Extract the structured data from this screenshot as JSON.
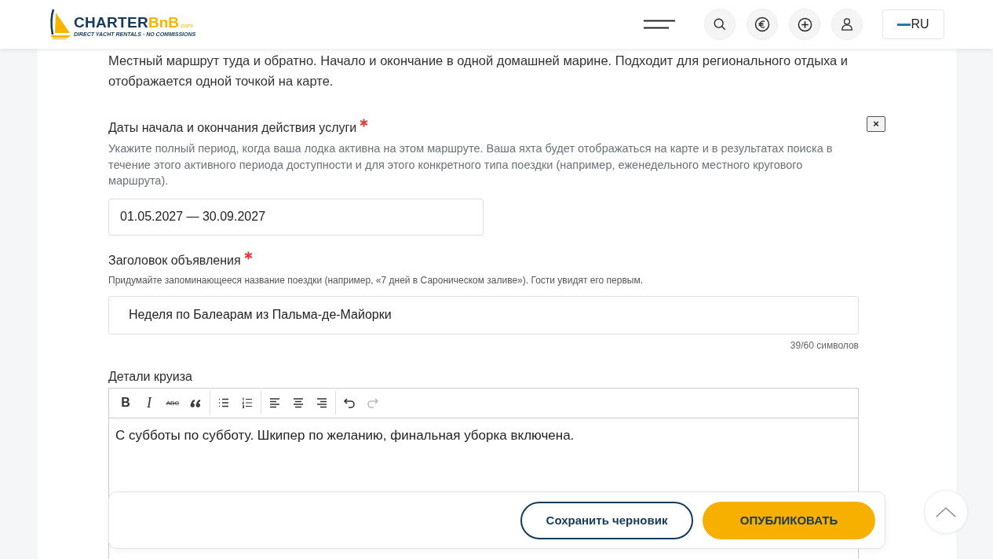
{
  "header": {
    "logo": {
      "brand": "CHARTER",
      "brand_accent": "BnB",
      "suffix": ".com",
      "tagline": "DIRECT YACHT RENTALS · NO COMMISSIONS"
    },
    "language": "RU"
  },
  "intro": "Местный маршрут туда и обратно. Начало и окончание в одной домашней марине. Подходит для регионального отдыха и отображается одной точкой на карте.",
  "dates": {
    "label": "Даты начала и окончания действия услуги",
    "required": true,
    "close": "×",
    "help": "Укажите полный период, когда ваша лодка активна на этом маршруте. Ваша яхта будет отображаться на карте и в результатах поиска в течение этого активного периода доступности и для этого конкретного типа поездки (например, еженедельного местного кругового маршрута).",
    "value": "01.05.2027 — 30.09.2027"
  },
  "title_field": {
    "label": "Заголовок объявления",
    "required": true,
    "help": "Придумайте запоминающееся название поездки (например, «7 дней в Сароническом заливе»). Гости увидят его первым.",
    "value": "Неделя по Балеарам из Пальма-де-Майорки",
    "counter": "39/60 символов"
  },
  "details": {
    "label": "Детали круиза",
    "toolbar_groups": [
      [
        {
          "kind": "bold",
          "label": "B",
          "disabled": false
        },
        {
          "kind": "italic",
          "label": "I",
          "disabled": false
        },
        {
          "kind": "strike",
          "label": "ABC",
          "disabled": false
        },
        {
          "kind": "quote",
          "disabled": false
        }
      ],
      [
        {
          "kind": "bullets",
          "disabled": false
        },
        {
          "kind": "numbers",
          "disabled": false
        }
      ],
      [
        {
          "kind": "align-left",
          "disabled": false
        },
        {
          "kind": "align-center",
          "disabled": false
        },
        {
          "kind": "align-right",
          "disabled": false
        }
      ],
      [
        {
          "kind": "undo",
          "disabled": false
        },
        {
          "kind": "redo",
          "disabled": true
        }
      ]
    ],
    "text": "С субботы по субботу. Шкипер по желанию, финальная уборка включена."
  },
  "actions": {
    "draft": "Сохранить черновик",
    "publish": "ОПУБЛИКОВАТЬ"
  }
}
